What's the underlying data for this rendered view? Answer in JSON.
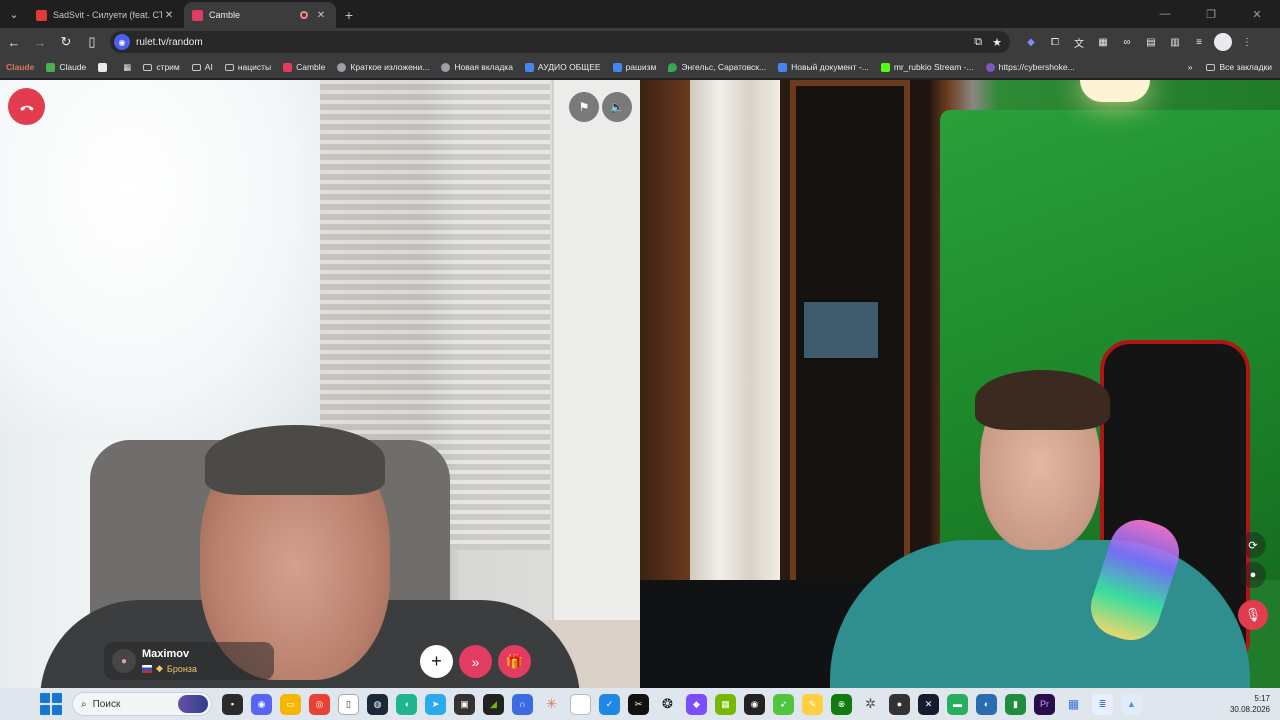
{
  "tabs": [
    {
      "title": "SadSvit - Силуети (feat. СТРУКТУ",
      "favicon_color": "#e53935",
      "active": false
    },
    {
      "title": "Camble",
      "favicon_color": "#e23c62",
      "active": true
    }
  ],
  "address": {
    "url": "rulet.tv/random"
  },
  "bookmarks": [
    {
      "label": "Claude",
      "color": "#d97757",
      "type": "text"
    },
    {
      "label": "Claude",
      "color": "#4caf50",
      "type": "link"
    },
    {
      "label": "",
      "color": "#e8eaed",
      "type": "square"
    },
    {
      "label": "",
      "color": "#e8eaed",
      "type": "grid"
    },
    {
      "label": "стрим",
      "type": "folder"
    },
    {
      "label": "AI",
      "type": "folder"
    },
    {
      "label": "нацисты",
      "type": "folder"
    },
    {
      "label": "Camble",
      "color": "#e23c62",
      "type": "link"
    },
    {
      "label": "Краткое изложени...",
      "color": "#9aa0a6",
      "type": "link"
    },
    {
      "label": "Новая вкладка",
      "color": "#9aa0a6",
      "type": "link"
    },
    {
      "label": "АУДИО ОБЩЕЕ",
      "color": "#4285f4",
      "type": "link"
    },
    {
      "label": "рашизм",
      "color": "#4285f4",
      "type": "link"
    },
    {
      "label": "Энгельс, Саратовск...",
      "color": "#34a853",
      "type": "link"
    },
    {
      "label": "Новый документ -...",
      "color": "#4285f4",
      "type": "link"
    },
    {
      "label": "mr_rubkio Stream -...",
      "color": "#2e7d32",
      "type": "link"
    },
    {
      "label": "https://cybershoke...",
      "color": "#7e57c2",
      "type": "link"
    }
  ],
  "bookmarks_more": "»",
  "all_bookmarks": "Все закладки",
  "peer": {
    "name": "Maximov",
    "rank": "Бронза"
  },
  "taskbar": {
    "search_label": "Поиск",
    "time": "5:17",
    "date": "30.08.2026"
  },
  "colors": {
    "accent": "#e23c62",
    "hangup": "#e23c4f"
  }
}
